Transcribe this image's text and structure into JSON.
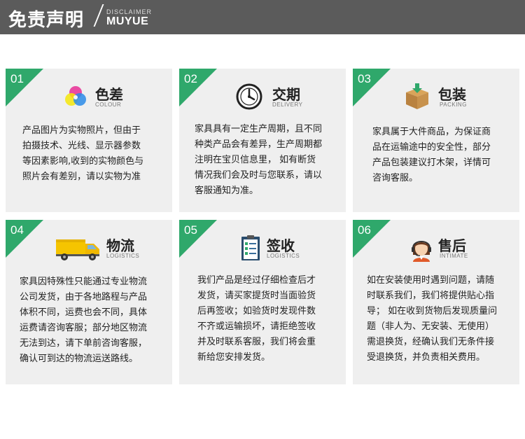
{
  "header": {
    "title": "免责声明",
    "en_small": "DISCLAIMER",
    "en_big": "MUYUE"
  },
  "cards": [
    {
      "number": "01",
      "title": "色差",
      "subtitle": "COLOUR",
      "icon": "color-circles-icon",
      "lines": [
        "产品图片为实物照片，但由于",
        "拍摄技术、光线、显示器参数",
        "等因素影响,收到的实物颜色与",
        "照片会有差别，请以实物为准"
      ]
    },
    {
      "number": "02",
      "title": "交期",
      "subtitle": "DELIVERY",
      "icon": "clock-icon",
      "lines": [
        "家具具有一定生产周期，且不同",
        "种类产品会有差异，生产周期都",
        "注明在宝贝信息里，  如有断货",
        "情况我们会及时与您联系，请以",
        "客服通知为准。"
      ]
    },
    {
      "number": "03",
      "title": "包装",
      "subtitle": "PACKING",
      "icon": "box-icon",
      "lines": [
        "家具属于大件商品，为保证商",
        "品在运输途中的安全性，部分",
        "产品包装建议打木架，详情可",
        "咨询客服。"
      ]
    },
    {
      "number": "04",
      "title": "物流",
      "subtitle": "LOGISTICS",
      "icon": "truck-icon",
      "lines": [
        "家具因特殊性只能通过专业物流",
        "公司发货，由于各地路程与产品",
        "体积不同，运费也会不同，具体",
        "运费请咨询客服；部分地区物流",
        "无法到达，请下单前咨询客服，",
        "确认可到达的物流运送路线。"
      ]
    },
    {
      "number": "05",
      "title": "签收",
      "subtitle": "LOGISTICS",
      "icon": "checklist-icon",
      "lines": [
        "我们产品是经过仔细检查后才",
        "发货，请买家提货时当面验货",
        "后再签收；如验货时发现件数",
        "不齐或运输损坏，请拒绝签收",
        "并及时联系客服，我们将会重",
        "新给您安排发货。"
      ]
    },
    {
      "number": "06",
      "title": "售后",
      "subtitle": "INTIMATE",
      "icon": "support-agent-icon",
      "lines": [
        "如在安装使用时遇到问题，请随",
        "时联系我们，我们将提供贴心指",
        "导；  如在收到货物后发现质量问",
        "题（非人为、无安装、无使用）",
        "需退换货，经确认我们无条件接",
        "受退换货，并负责相关费用。"
      ]
    }
  ],
  "colors": {
    "accent": "#2fa86b",
    "header_bg": "#5b5b5b",
    "card_bg": "#efefef"
  }
}
